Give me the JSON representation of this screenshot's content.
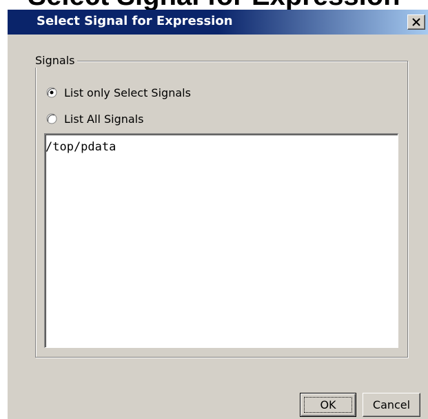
{
  "page_caption": "Select Signal for Expression",
  "window": {
    "title": "Select Signal for Expression",
    "close_icon": "close-x-icon"
  },
  "group": {
    "legend": "Signals"
  },
  "radios": [
    {
      "label": "List only Select Signals",
      "selected": true
    },
    {
      "label": "List All Signals",
      "selected": false
    }
  ],
  "signal_list": {
    "items": [
      "/top/pdata"
    ]
  },
  "buttons": {
    "ok_label": "OK",
    "cancel_label": "Cancel"
  },
  "colors": {
    "dialog_face": "#d4d0c8",
    "title_bar_start": "#0a246a",
    "title_bar_end": "#a6caf0",
    "title_text": "#ffffff"
  }
}
